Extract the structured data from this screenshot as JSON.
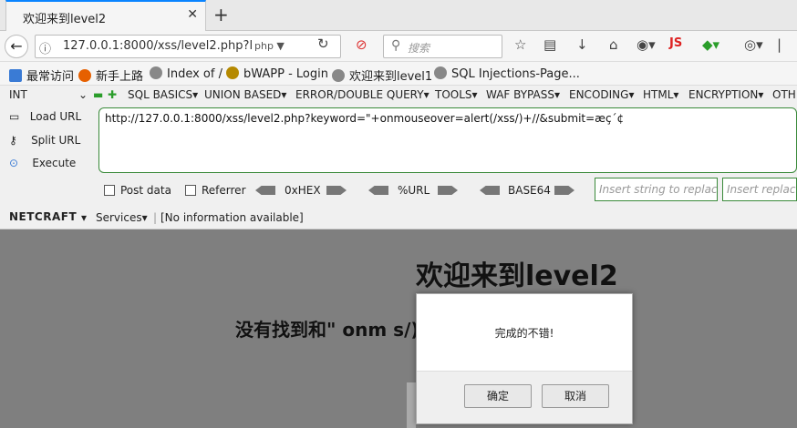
{
  "window": {
    "tab_title": "欢迎来到level2",
    "tab_close": "✕",
    "new_tab": "+"
  },
  "navbar": {
    "url": "127.0.0.1:8000/xss/level2.php?l",
    "url_extra": "php ▼",
    "search_placeholder": "搜索",
    "js_label": "JS"
  },
  "bookmarks": [
    {
      "label": "最常访问",
      "color": "#3a7bd5"
    },
    {
      "label": "新手上路",
      "color": "#e66000"
    },
    {
      "label": "Index of /",
      "color": "#777"
    },
    {
      "label": "bWAPP - Login",
      "color": "#b58900"
    },
    {
      "label": "欢迎来到level1",
      "color": "#777"
    },
    {
      "label": "SQL Injections-Page...",
      "color": "#777"
    }
  ],
  "hackbar": {
    "version": "INT",
    "menus": [
      "SQL BASICS▾",
      "UNION BASED▾",
      "ERROR/DOUBLE QUERY▾",
      "TOOLS▾",
      "WAF BYPASS▾",
      "ENCODING▾",
      "HTML▾",
      "ENCRYPTION▾",
      "OTH"
    ],
    "load_url": "Load URL",
    "split_url": "Split URL",
    "execute": "Execute",
    "url_value": "http://127.0.0.1:8000/xss/level2.php?keyword=\"+onmouseover=alert(/xss/)+//&submit=æç´¢",
    "post_data": "Post data",
    "referrer": "Referrer",
    "hex": "0xHEX",
    "url_enc": "%URL",
    "base64": "BASE64",
    "insert1": "Insert string to replace",
    "insert2": "Insert replacing"
  },
  "netcraft": {
    "logo": "NETCRAFT",
    "services": "Services▾",
    "info": "[No information available]"
  },
  "page": {
    "heading": "欢迎来到level2",
    "result": "没有找到和\" onm                              s/) //相关的结果."
  },
  "dialog": {
    "message": "完成的不错!",
    "ok": "确定",
    "cancel": "取消"
  }
}
